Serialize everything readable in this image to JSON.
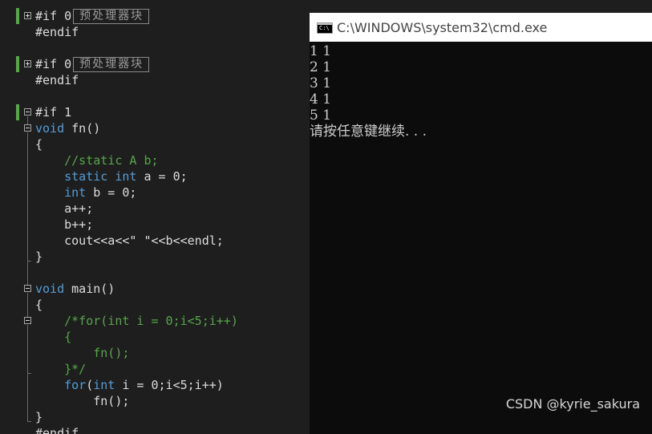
{
  "editor": {
    "lines": {
      "l0_directive": "#if 0",
      "l0_collapsed": "预处理器块",
      "l1": "#endif",
      "l3_directive": "#if 0",
      "l3_collapsed": "预处理器块",
      "l4": "#endif",
      "l6": "#if 1",
      "l7_kw": "void",
      "l7_rest": " fn()",
      "l8": "{",
      "l9": "    //static A b;",
      "l10_kw1": "static",
      "l10_kw2": "int",
      "l10_rest": " a = 0;",
      "l11_kw": "int",
      "l11_rest": " b = 0;",
      "l12": "    a++;",
      "l13": "    b++;",
      "l14": "    cout<<a<<\" \"<<b<<endl;",
      "l15": "}",
      "l17_kw": "void",
      "l17_rest": " main()",
      "l18": "{",
      "l19": "    /*for(int i = 0;i<5;i++)",
      "l20": "    {",
      "l21": "        fn();",
      "l22": "    }*/",
      "l23_kw1": "for",
      "l23_mid": "(",
      "l23_kw2": "int",
      "l23_rest": " i = 0;i<5;i++)",
      "l24": "        fn();",
      "l25": "}",
      "l26": "#endif"
    }
  },
  "console": {
    "title": "C:\\WINDOWS\\system32\\cmd.exe",
    "icon_text": "C:\\",
    "output": [
      "1 1",
      "2 1",
      "3 1",
      "4 1",
      "5 1",
      "请按任意键继续. . ."
    ]
  },
  "watermark": "CSDN @kyrie_sakura",
  "colors": {
    "keyword": "#569cd6",
    "comment": "#57a64a",
    "text": "#dcdcdc",
    "editor_bg": "#1e1e1e",
    "console_bg": "#0c0c0c"
  }
}
